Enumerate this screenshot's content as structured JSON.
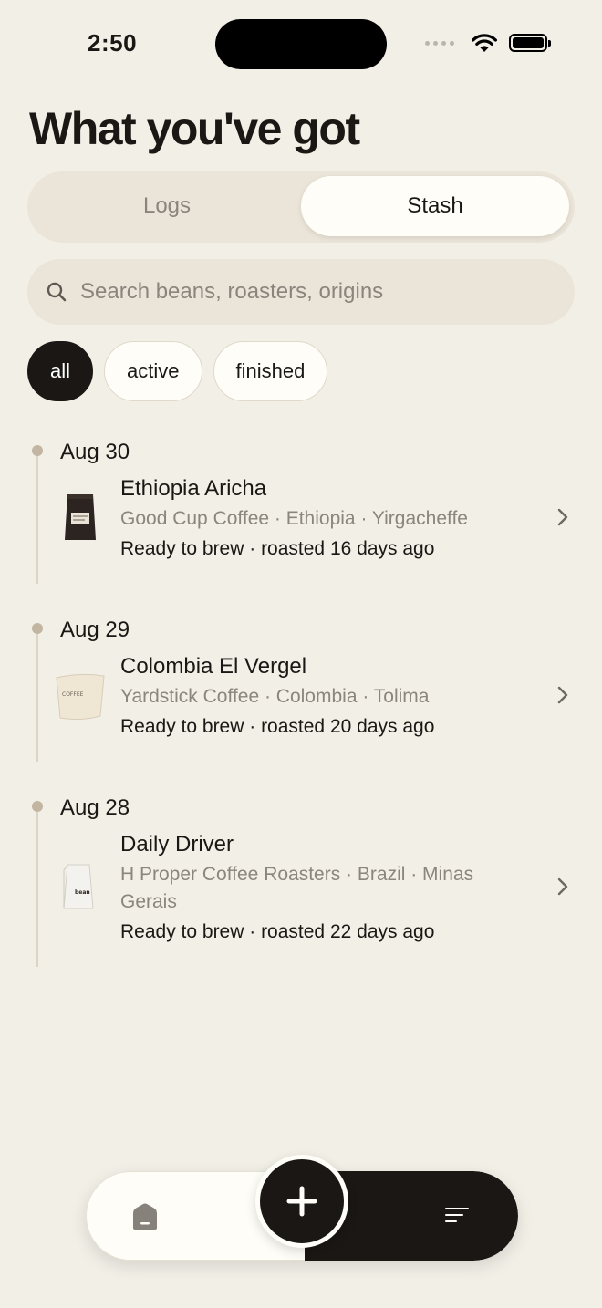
{
  "status_bar": {
    "time": "2:50"
  },
  "header": {
    "title": "What you've got"
  },
  "segmented": {
    "tabs": [
      {
        "label": "Logs",
        "selected": false
      },
      {
        "label": "Stash",
        "selected": true
      }
    ]
  },
  "search": {
    "placeholder": "Search beans, roasters, origins"
  },
  "filters": [
    {
      "label": "all",
      "active": true
    },
    {
      "label": "active",
      "active": false
    },
    {
      "label": "finished",
      "active": false
    }
  ],
  "entries": [
    {
      "date": "Aug 30",
      "name": "Ethiopia Aricha",
      "meta": "Good Cup Coffee · Ethiopia · Yirgacheffe",
      "status": "Ready to brew · roasted 16 days ago",
      "thumb_icon": "dark-coffee-bag-icon"
    },
    {
      "date": "Aug 29",
      "name": "Colombia El Vergel",
      "meta": "Yardstick Coffee · Colombia · Tolima",
      "status": "Ready to brew · roasted 20 days ago",
      "thumb_icon": "cream-coffee-bag-icon"
    },
    {
      "date": "Aug 28",
      "name": "Daily Driver",
      "meta": "H Proper Coffee Roasters · Brazil · Minas Gerais",
      "status": "Ready to brew · roasted 22 days ago",
      "thumb_icon": "white-coffee-bag-icon"
    }
  ],
  "colors": {
    "background": "#f2efe7",
    "accent_dark": "#1a1714",
    "muted_text": "#8a857d",
    "timeline_dot": "#c2b5a1"
  }
}
